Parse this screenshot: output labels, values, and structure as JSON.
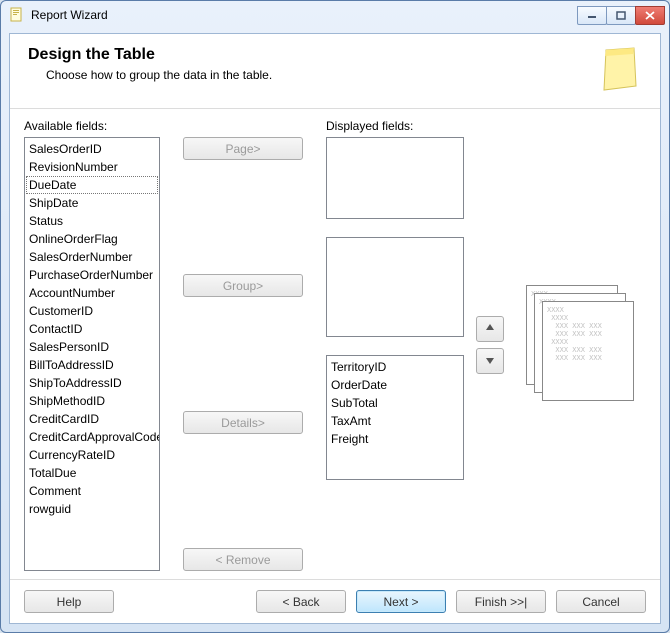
{
  "window": {
    "title": "Report Wizard"
  },
  "header": {
    "title": "Design the Table",
    "subtitle": "Choose how to group the data in the table."
  },
  "labels": {
    "available": "Available fields:",
    "displayed": "Displayed fields:"
  },
  "buttons": {
    "page": "Page>",
    "group": "Group>",
    "details": "Details>",
    "remove": "< Remove",
    "help": "Help",
    "back": "< Back",
    "next": "Next >",
    "finish": "Finish >>|",
    "cancel": "Cancel"
  },
  "available_fields": {
    "selected": "DueDate",
    "items": [
      "SalesOrderID",
      "RevisionNumber",
      "DueDate",
      "ShipDate",
      "Status",
      "OnlineOrderFlag",
      "SalesOrderNumber",
      "PurchaseOrderNumber",
      "AccountNumber",
      "CustomerID",
      "ContactID",
      "SalesPersonID",
      "BillToAddressID",
      "ShipToAddressID",
      "ShipMethodID",
      "CreditCardID",
      "CreditCardApprovalCode",
      "CurrencyRateID",
      "TotalDue",
      "Comment",
      "rowguid"
    ]
  },
  "page_fields": [],
  "group_fields": [],
  "details_fields": [
    "TerritoryID",
    "OrderDate",
    "SubTotal",
    "TaxAmt",
    "Freight"
  ]
}
